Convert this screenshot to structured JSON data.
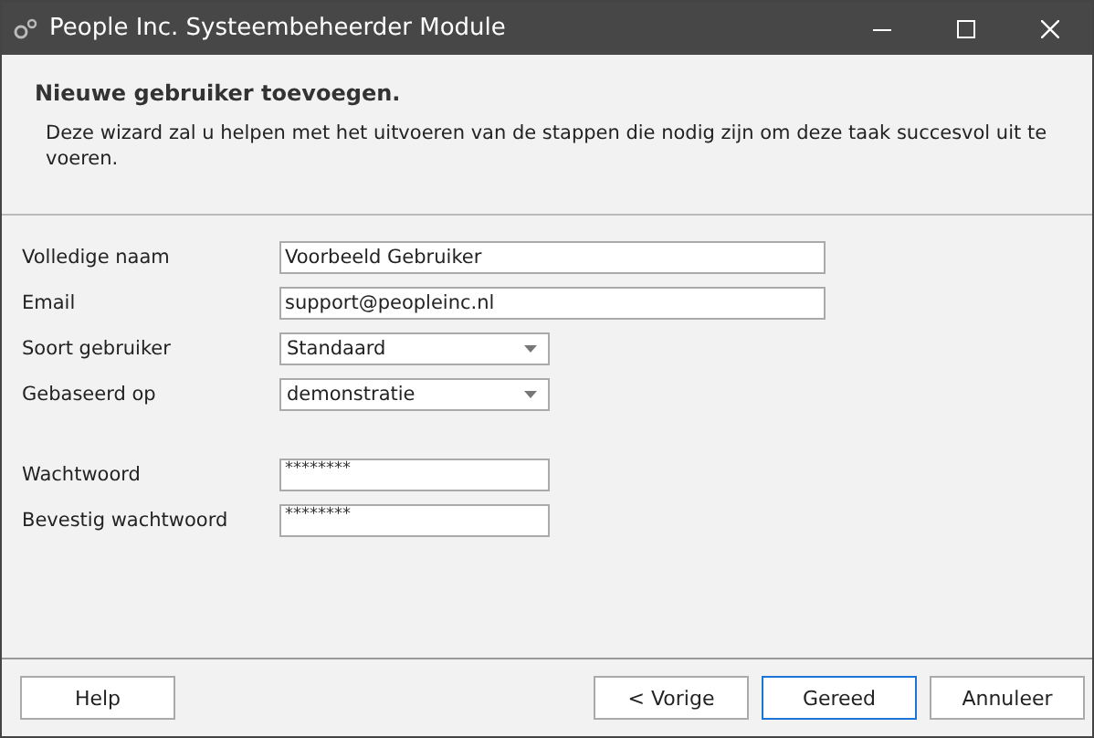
{
  "window": {
    "title": "People Inc. Systeembeheerder Module"
  },
  "header": {
    "title": "Nieuwe gebruiker toevoegen.",
    "description": "Deze wizard zal u helpen met het uitvoeren van de stappen die nodig zijn om deze taak succesvol uit te voeren."
  },
  "form": {
    "groups": [
      [
        {
          "label": "Volledige naam",
          "kind": "text",
          "value": "Voorbeeld Gebruiker"
        },
        {
          "label": "Email",
          "kind": "text",
          "value": "support@peopleinc.nl"
        },
        {
          "label": "Soort gebruiker",
          "kind": "dropdown",
          "value": "Standaard"
        },
        {
          "label": "Gebaseerd op",
          "kind": "dropdown",
          "value": "demonstratie"
        }
      ],
      [
        {
          "label": "Wachtwoord",
          "kind": "password",
          "value": "********"
        },
        {
          "label": "Bevestig wachtwoord",
          "kind": "password",
          "value": "********"
        }
      ]
    ]
  },
  "buttons": [
    {
      "label": "Help",
      "focused": false
    },
    {
      "label": "< Vorige",
      "focused": false
    },
    {
      "label": "Gereed",
      "focused": true
    },
    {
      "label": "Annuleer",
      "focused": false
    }
  ]
}
